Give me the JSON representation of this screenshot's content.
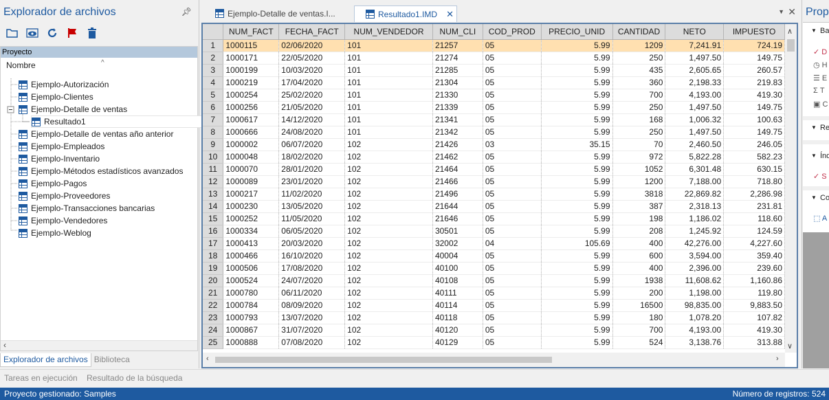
{
  "explorer": {
    "title": "Explorador de archivos",
    "project_header": "Proyecto",
    "column_header": "Nombre",
    "items": [
      "Ejemplo-Autorización",
      "Ejemplo-Clientes",
      "Ejemplo-Detalle de ventas",
      "Resultado1",
      "Ejemplo-Detalle de ventas año anterior",
      "Ejemplo-Empleados",
      "Ejemplo-Inventario",
      "Ejemplo-Métodos estadísticos avanzados",
      "Ejemplo-Pagos",
      "Ejemplo-Proveedores",
      "Ejemplo-Transacciones bancarias",
      "Ejemplo-Vendedores",
      "Ejemplo-Weblog"
    ],
    "bottom_tabs": [
      "Explorador de archivos",
      "Biblioteca"
    ]
  },
  "task_tabs": [
    "Tareas en ejecución",
    "Resultado de la búsqueda"
  ],
  "status": {
    "left": "Proyecto gestionado: Samples",
    "right": "Número de registros: 524"
  },
  "doc_tabs": [
    {
      "label": "Ejemplo-Detalle de ventas.I...",
      "active": false
    },
    {
      "label": "Resultado1.IMD",
      "active": true
    }
  ],
  "grid": {
    "columns": [
      "NUM_FACT",
      "FECHA_FACT",
      "NUM_VENDEDOR",
      "NUM_CLI",
      "COD_PROD",
      "PRECIO_UNID",
      "CANTIDAD",
      "NETO",
      "IMPUESTO"
    ],
    "rows": [
      [
        "1",
        "1000115",
        "02/06/2020",
        "101",
        "21257",
        "05",
        "5.99",
        "1209",
        "7,241.91",
        "724.19"
      ],
      [
        "2",
        "1000171",
        "22/05/2020",
        "101",
        "21274",
        "05",
        "5.99",
        "250",
        "1,497.50",
        "149.75"
      ],
      [
        "3",
        "1000199",
        "10/03/2020",
        "101",
        "21285",
        "05",
        "5.99",
        "435",
        "2,605.65",
        "260.57"
      ],
      [
        "4",
        "1000219",
        "17/04/2020",
        "101",
        "21304",
        "05",
        "5.99",
        "360",
        "2,198.33",
        "219.83"
      ],
      [
        "5",
        "1000254",
        "25/02/2020",
        "101",
        "21330",
        "05",
        "5.99",
        "700",
        "4,193.00",
        "419.30"
      ],
      [
        "6",
        "1000256",
        "21/05/2020",
        "101",
        "21339",
        "05",
        "5.99",
        "250",
        "1,497.50",
        "149.75"
      ],
      [
        "7",
        "1000617",
        "14/12/2020",
        "101",
        "21341",
        "05",
        "5.99",
        "168",
        "1,006.32",
        "100.63"
      ],
      [
        "8",
        "1000666",
        "24/08/2020",
        "101",
        "21342",
        "05",
        "5.99",
        "250",
        "1,497.50",
        "149.75"
      ],
      [
        "9",
        "1000002",
        "06/07/2020",
        "102",
        "21426",
        "03",
        "35.15",
        "70",
        "2,460.50",
        "246.05"
      ],
      [
        "10",
        "1000048",
        "18/02/2020",
        "102",
        "21462",
        "05",
        "5.99",
        "972",
        "5,822.28",
        "582.23"
      ],
      [
        "11",
        "1000070",
        "28/01/2020",
        "102",
        "21464",
        "05",
        "5.99",
        "1052",
        "6,301.48",
        "630.15"
      ],
      [
        "12",
        "1000089",
        "23/01/2020",
        "102",
        "21466",
        "05",
        "5.99",
        "1200",
        "7,188.00",
        "718.80"
      ],
      [
        "13",
        "1000217",
        "11/02/2020",
        "102",
        "21496",
        "05",
        "5.99",
        "3818",
        "22,869.82",
        "2,286.98"
      ],
      [
        "14",
        "1000230",
        "13/05/2020",
        "102",
        "21644",
        "05",
        "5.99",
        "387",
        "2,318.13",
        "231.81"
      ],
      [
        "15",
        "1000252",
        "11/05/2020",
        "102",
        "21646",
        "05",
        "5.99",
        "198",
        "1,186.02",
        "118.60"
      ],
      [
        "16",
        "1000334",
        "06/05/2020",
        "102",
        "30501",
        "05",
        "5.99",
        "208",
        "1,245.92",
        "124.59"
      ],
      [
        "17",
        "1000413",
        "20/03/2020",
        "102",
        "32002",
        "04",
        "105.69",
        "400",
        "42,276.00",
        "4,227.60"
      ],
      [
        "18",
        "1000466",
        "16/10/2020",
        "102",
        "40004",
        "05",
        "5.99",
        "600",
        "3,594.00",
        "359.40"
      ],
      [
        "19",
        "1000506",
        "17/08/2020",
        "102",
        "40100",
        "05",
        "5.99",
        "400",
        "2,396.00",
        "239.60"
      ],
      [
        "20",
        "1000524",
        "24/07/2020",
        "102",
        "40108",
        "05",
        "5.99",
        "1938",
        "11,608.62",
        "1,160.86"
      ],
      [
        "21",
        "1000780",
        "06/11/2020",
        "102",
        "40111",
        "05",
        "5.99",
        "200",
        "1,198.00",
        "119.80"
      ],
      [
        "22",
        "1000784",
        "08/09/2020",
        "102",
        "40114",
        "05",
        "5.99",
        "16500",
        "98,835.00",
        "9,883.50"
      ],
      [
        "23",
        "1000793",
        "13/07/2020",
        "102",
        "40118",
        "05",
        "5.99",
        "180",
        "1,078.20",
        "107.82"
      ],
      [
        "24",
        "1000867",
        "31/07/2020",
        "102",
        "40120",
        "05",
        "5.99",
        "700",
        "4,193.00",
        "419.30"
      ],
      [
        "25",
        "1000888",
        "07/08/2020",
        "102",
        "40129",
        "05",
        "5.99",
        "524",
        "3,138.76",
        "313.88"
      ]
    ]
  },
  "properties": {
    "title": "Propi",
    "sections": [
      "Ba",
      "Re",
      "Índ",
      "Co"
    ],
    "items": [
      "D",
      "H",
      "E",
      "T",
      "C",
      "S",
      "A"
    ]
  },
  "colors": {
    "accent": "#1e5aa0",
    "selected_row": "#ffe0b0",
    "header": "#dcdcdc",
    "toolbar_red": "#c80000"
  }
}
